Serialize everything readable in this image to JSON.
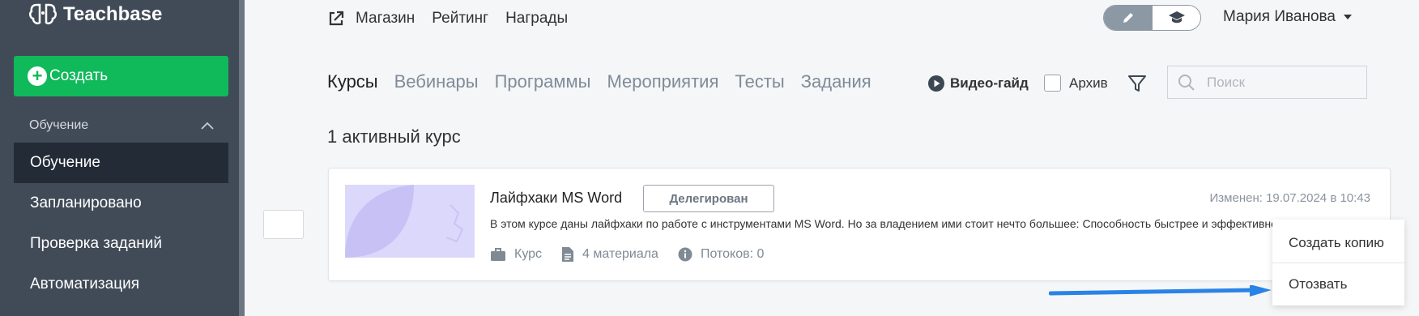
{
  "app": {
    "name": "Teachbase"
  },
  "sidebar": {
    "create_label": "Создать",
    "section_label": "Обучение",
    "items": [
      {
        "label": "Обучение",
        "active": true
      },
      {
        "label": "Запланировано"
      },
      {
        "label": "Проверка заданий"
      },
      {
        "label": "Автоматизация"
      }
    ]
  },
  "topnav": {
    "links": [
      "Магазин",
      "Рейтинг",
      "Награды"
    ],
    "user_name": "Мария Иванова"
  },
  "tabs": [
    "Курсы",
    "Вебинары",
    "Программы",
    "Мероприятия",
    "Тесты",
    "Задания"
  ],
  "toolbar": {
    "video_guide": "Видео-гайд",
    "archive": "Архив",
    "search_placeholder": "Поиск"
  },
  "content": {
    "count_title": "1 активный курс",
    "course": {
      "title": "Лайфхаки MS Word",
      "status": "Делегирован",
      "modified": "Изменен: 19.07.2024 в 10:43",
      "description": "В этом курсе даны лайфхаки по работе с инструментами MS Word. Но за владением ими стоит нечто большее: Способность быстрее и эффективнее",
      "type": "Курс",
      "materials": "4 материала",
      "streams": "Потоков: 0"
    }
  },
  "context_menu": {
    "copy": "Создать копию",
    "revoke": "Отозвать"
  },
  "colors": {
    "sidebar": "#414b57",
    "accent_green": "#10b95a",
    "arrow_blue": "#2a83e6"
  }
}
